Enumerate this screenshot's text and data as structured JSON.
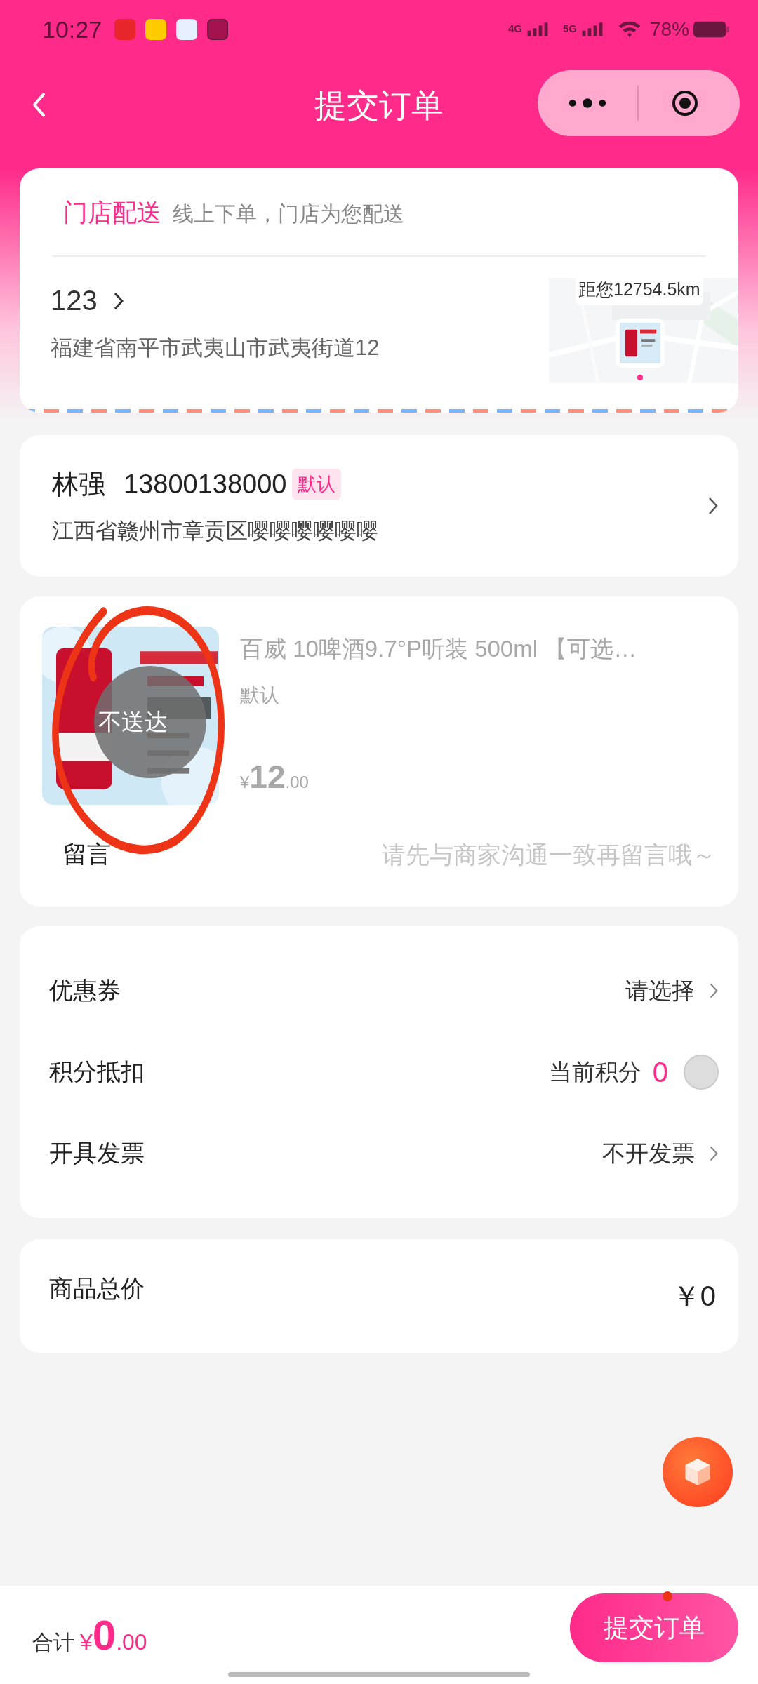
{
  "status_bar": {
    "time": "10:27",
    "network_1": "4G",
    "network_2": "5G",
    "battery": "78%"
  },
  "header": {
    "title": "提交订单"
  },
  "store": {
    "mode": "门店配送",
    "mode_hint": "线上下单，门店为您配送",
    "name": "123",
    "address": "福建省南平市武夷山市武夷街道12",
    "map_distance": "距您12754.5km"
  },
  "contact": {
    "name": "林强",
    "phone": "13800138000",
    "badge": "默认",
    "address": "江西省赣州市章贡区嘤嘤嘤嘤嘤嘤"
  },
  "product": {
    "title": "百威 10啤酒9.7°P听装 500ml 【可选…",
    "spec": "默认",
    "price_symbol": "¥",
    "price_int": "12",
    "price_dec": ".00",
    "overlay": "不送达",
    "message_label": "留言",
    "message_placeholder": "请先与商家沟通一致再留言哦～"
  },
  "options": [
    {
      "kind": "select",
      "label": "优惠券",
      "value": "请选择"
    },
    {
      "kind": "points",
      "label": "积分抵扣",
      "value": "当前积分",
      "points": "0",
      "checked": false
    },
    {
      "kind": "select",
      "label": "开具发票",
      "value": "不开发票"
    }
  ],
  "summary": {
    "label": "商品总价",
    "value": "￥0"
  },
  "footer": {
    "label": "合计",
    "symbol": "¥",
    "int": "0",
    "dec": ".00",
    "submit": "提交订单"
  }
}
